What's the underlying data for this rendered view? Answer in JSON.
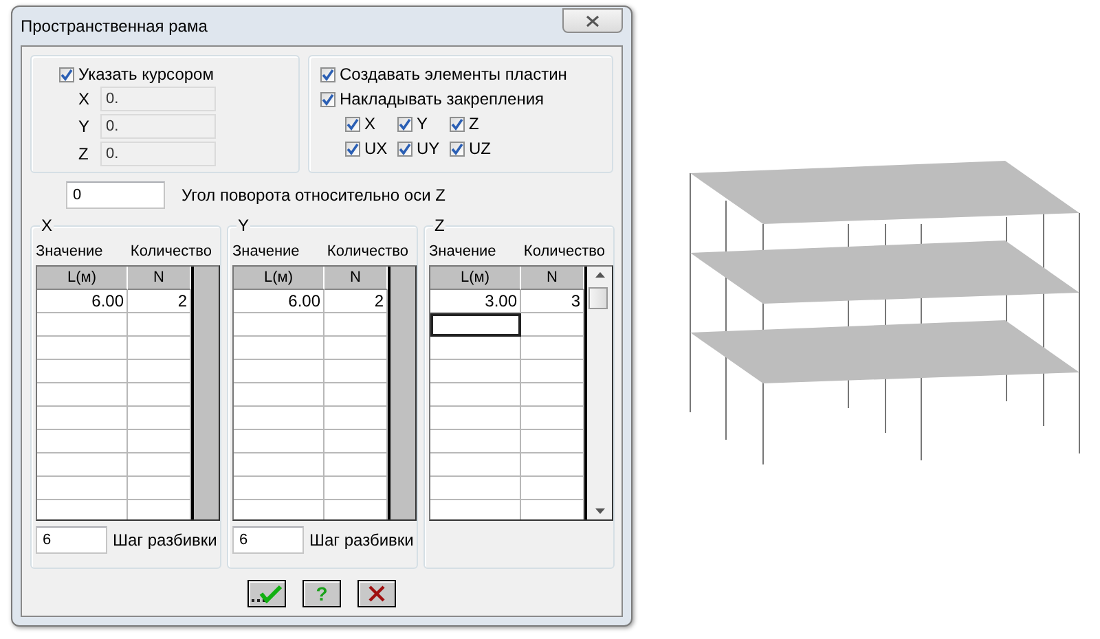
{
  "window": {
    "title": "Пространственная рама"
  },
  "cursor": {
    "label": "Указать курсором",
    "checked": true,
    "coords": [
      {
        "label": "X",
        "value": "0."
      },
      {
        "label": "Y",
        "value": "0."
      },
      {
        "label": "Z",
        "value": "0."
      }
    ]
  },
  "options": [
    {
      "label": "Создавать элементы пластин",
      "checked": true
    },
    {
      "label": "Накладывать закрепления",
      "checked": true
    }
  ],
  "constraints": [
    {
      "label": "X",
      "checked": true
    },
    {
      "label": "Y",
      "checked": true
    },
    {
      "label": "Z",
      "checked": true
    },
    {
      "label": "UX",
      "checked": true
    },
    {
      "label": "UY",
      "checked": true
    },
    {
      "label": "UZ",
      "checked": true
    }
  ],
  "angle": {
    "value": "0",
    "label": "Угол поворота относительно оси Z"
  },
  "axes": [
    {
      "title": "X",
      "headers": [
        "Значение",
        "Количество"
      ],
      "columns": [
        "L(м)",
        "N"
      ],
      "rows": [
        [
          "6.00",
          "2"
        ]
      ],
      "entry_cursor": false,
      "scrollbar": false,
      "step": {
        "value": "6",
        "label": "Шаг разбивки"
      }
    },
    {
      "title": "Y",
      "headers": [
        "Значение",
        "Количество"
      ],
      "columns": [
        "L(м)",
        "N"
      ],
      "rows": [
        [
          "6.00",
          "2"
        ]
      ],
      "entry_cursor": false,
      "scrollbar": false,
      "step": {
        "value": "6",
        "label": "Шаг разбивки"
      }
    },
    {
      "title": "Z",
      "headers": [
        "Значение",
        "Количество"
      ],
      "columns": [
        "L(м)",
        "N"
      ],
      "rows": [
        [
          "3.00",
          "3"
        ]
      ],
      "entry_cursor": true,
      "scrollbar": true
    }
  ],
  "buttons": [
    {
      "kind": "ok"
    },
    {
      "kind": "help",
      "label": "?"
    },
    {
      "kind": "cancel"
    }
  ]
}
